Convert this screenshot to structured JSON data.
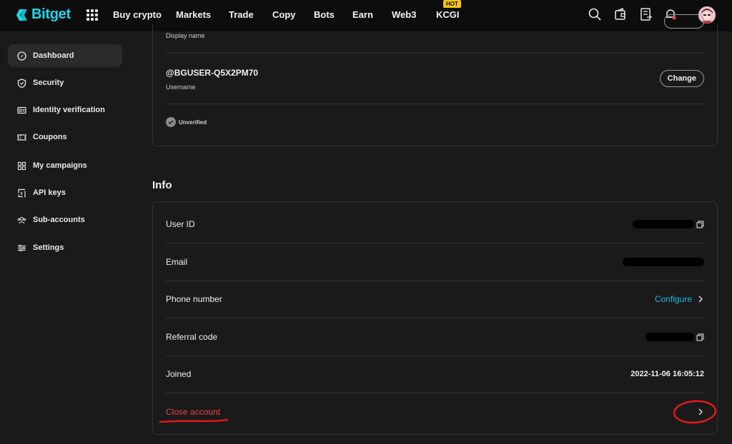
{
  "brand": {
    "name": "Bitget",
    "accent": "#1dd6e8"
  },
  "nav": {
    "items": [
      "Buy crypto",
      "Markets",
      "Trade",
      "Copy",
      "Bots",
      "Earn",
      "Web3",
      "KCGI"
    ],
    "hot_badge": "HOT"
  },
  "top_icons": [
    "search-icon",
    "wallet-icon",
    "orders-icon",
    "bell-icon"
  ],
  "sidebar": {
    "items": [
      {
        "label": "Dashboard",
        "icon": "compass-icon",
        "active": true
      },
      {
        "label": "Security",
        "icon": "shield-icon"
      },
      {
        "label": "Identity verification",
        "icon": "id-card-icon"
      },
      {
        "label": "Coupons",
        "icon": "ticket-icon"
      },
      {
        "label": "My campaigns",
        "icon": "grid-icon"
      },
      {
        "label": "API keys",
        "icon": "api-icon"
      },
      {
        "label": "Sub-accounts",
        "icon": "users-icon"
      },
      {
        "label": "Settings",
        "icon": "sliders-icon"
      }
    ]
  },
  "profile": {
    "display_name_label": "Display name",
    "username": "@BGUSER-Q5X2PM70",
    "username_label": "Username",
    "change_label": "Change",
    "verification_status": "Unverified"
  },
  "info": {
    "title": "Info",
    "rows": {
      "user_id": {
        "label": "User ID"
      },
      "email": {
        "label": "Email"
      },
      "phone": {
        "label": "Phone number",
        "action": "Configure"
      },
      "referral": {
        "label": "Referral code"
      },
      "joined": {
        "label": "Joined",
        "value": "2022-11-06 16:05:12"
      },
      "close": {
        "label": "Close account"
      }
    }
  },
  "colors": {
    "danger": "#e84545",
    "link": "#1dbde0",
    "annotation": "#e01818"
  }
}
